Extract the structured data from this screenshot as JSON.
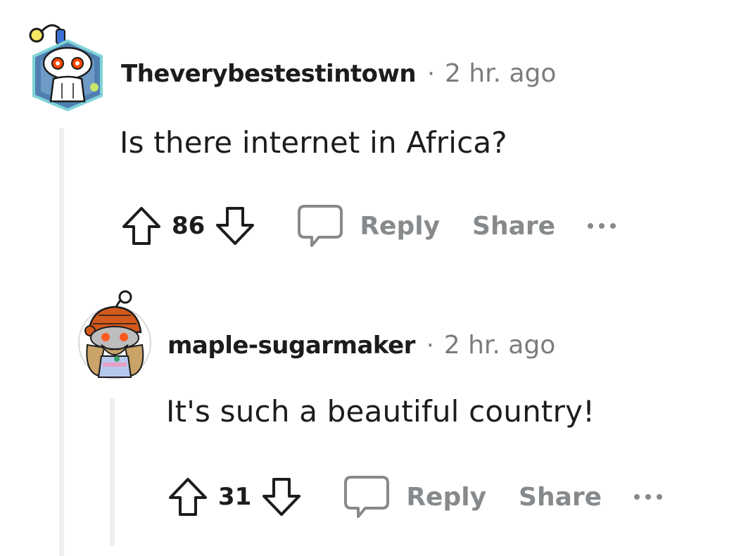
{
  "comments": [
    {
      "username": "Theverybestestintown",
      "separator": "·",
      "timestamp": "2 hr. ago",
      "body": "Is there internet in Africa?",
      "score": "86",
      "reply_label": "Reply",
      "share_label": "Share",
      "avatar_icon": "snoo-avatar-icon"
    },
    {
      "username": "maple-sugarmaker",
      "separator": "·",
      "timestamp": "2 hr. ago",
      "body": "It's such a beautiful country!",
      "score": "31",
      "reply_label": "Reply",
      "share_label": "Share",
      "avatar_icon": "snoo-avatar-icon"
    }
  ],
  "colors": {
    "text": "#1c1c1c",
    "meta": "#7c7c7c",
    "action": "#878a8c",
    "thread_line": "#edeff1"
  }
}
